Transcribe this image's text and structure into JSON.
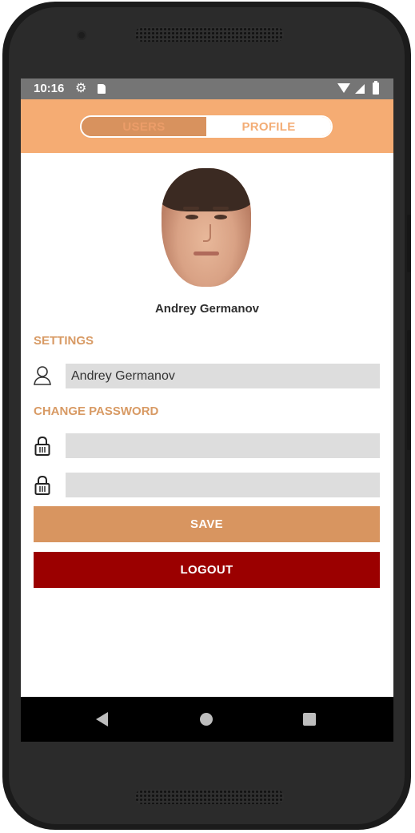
{
  "status_bar": {
    "time": "10:16",
    "icons": [
      "gear-icon",
      "sd-card-icon",
      "wifi-icon",
      "signal-icon",
      "battery-icon"
    ]
  },
  "tabs": {
    "users_label": "USERS",
    "profile_label": "PROFILE",
    "active": "PROFILE"
  },
  "profile": {
    "name": "Andrey Germanov"
  },
  "settings": {
    "title": "SETTINGS",
    "name_value": "Andrey Germanov",
    "name_icon": "user-icon"
  },
  "change_password": {
    "title": "CHANGE PASSWORD",
    "password_value": "",
    "confirm_value": "",
    "icon": "lock-icon"
  },
  "buttons": {
    "save_label": "SAVE",
    "logout_label": "LOGOUT"
  },
  "navigation": {
    "icons": [
      "back-icon",
      "home-icon",
      "recents-icon"
    ]
  },
  "colors": {
    "header": "#f5ac73",
    "section_title": "#d89a64",
    "save_button": "#d89560",
    "logout_button": "#9b0000",
    "field_background": "#dddddd"
  }
}
